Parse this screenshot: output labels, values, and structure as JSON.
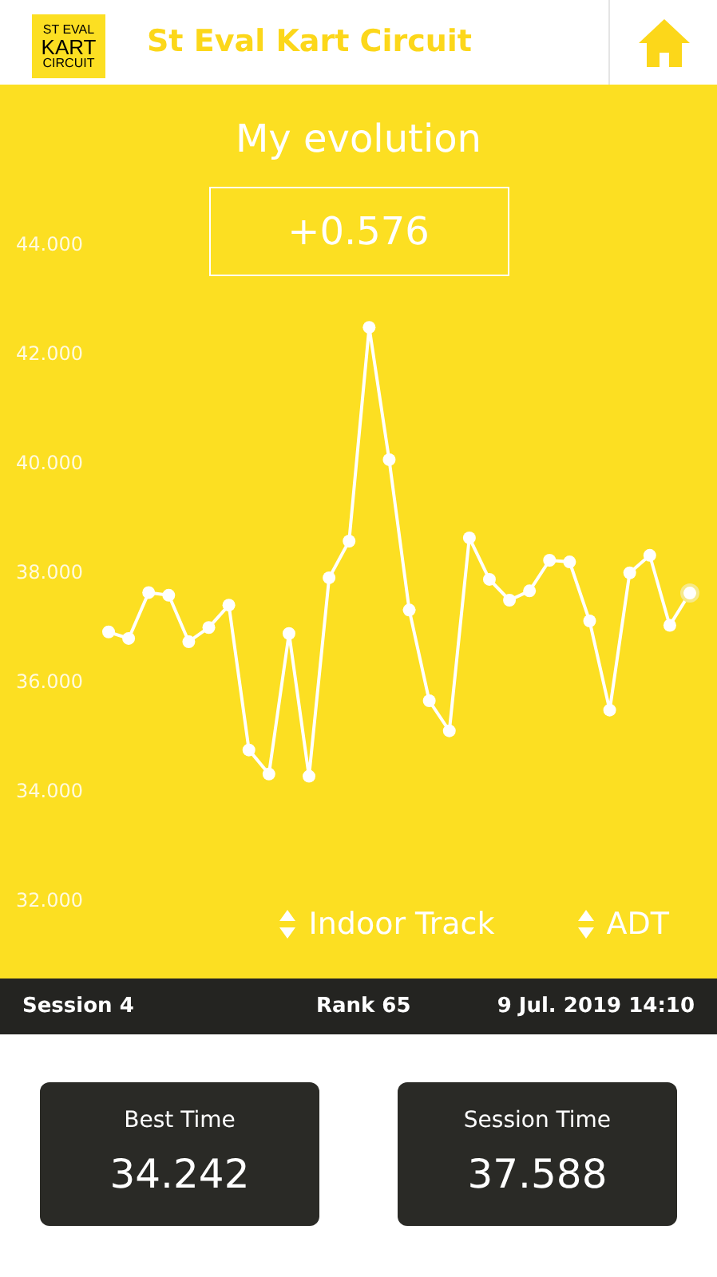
{
  "header": {
    "logo_lines": [
      "ST EVAL",
      "KART",
      "CIRCUIT"
    ],
    "title": "St Eval Kart Circuit"
  },
  "evolution": {
    "title": "My evolution",
    "delta": "+0.576",
    "chart_data": {
      "type": "line",
      "ylim": [
        32,
        44
      ],
      "yticks": [
        {
          "value": 44,
          "label": "44.000"
        },
        {
          "value": 42,
          "label": "42.000"
        },
        {
          "value": 40,
          "label": "40.000"
        },
        {
          "value": 38,
          "label": "38.000"
        },
        {
          "value": 36,
          "label": "36.000"
        },
        {
          "value": 34,
          "label": "34.000"
        },
        {
          "value": 32,
          "label": "32.000"
        }
      ],
      "series": [
        {
          "color": "#ffffff",
          "marker": "circle",
          "values": [
            36.88,
            36.76,
            37.6,
            37.55,
            36.7,
            36.96,
            37.37,
            34.72,
            34.28,
            36.85,
            34.24,
            37.87,
            38.54,
            42.45,
            40.03,
            37.28,
            35.62,
            35.07,
            38.6,
            37.84,
            37.46,
            37.63,
            38.19,
            38.16,
            37.08,
            35.45,
            37.96,
            38.28,
            37.0,
            37.59
          ]
        }
      ]
    },
    "selectors": [
      {
        "label": "Indoor Track"
      },
      {
        "label": "ADT"
      }
    ]
  },
  "session_bar": {
    "session": "Session 4",
    "rank": "Rank 65",
    "date": "9 Jul. 2019 14:10"
  },
  "cards": [
    {
      "label": "Best Time",
      "value": "34.242"
    },
    {
      "label": "Session Time",
      "value": "37.588"
    }
  ]
}
